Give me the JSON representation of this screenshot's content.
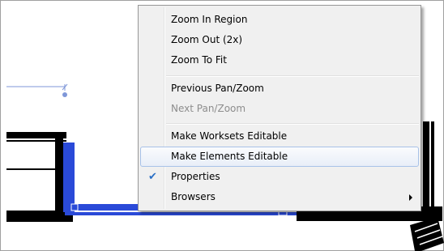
{
  "context_menu": {
    "items": [
      {
        "label": "Zoom In Region"
      },
      {
        "label": "Zoom Out (2x)"
      },
      {
        "label": "Zoom To Fit"
      },
      {
        "label": "Previous Pan/Zoom"
      },
      {
        "label": "Next Pan/Zoom",
        "state": "disabled"
      },
      {
        "label": "Make Worksets Editable"
      },
      {
        "label": "Make Elements Editable",
        "state": "highlighted"
      },
      {
        "label": "Properties",
        "icon": "checkmark-icon",
        "checked": true
      },
      {
        "label": "Browsers",
        "icon": "submenu-arrow-icon"
      }
    ]
  },
  "colors": {
    "selection_blue": "#2a4ad8",
    "menu_background": "#f0f0f0",
    "hover_border": "#a8c2e8",
    "disabled_text": "#8d8d8d"
  }
}
